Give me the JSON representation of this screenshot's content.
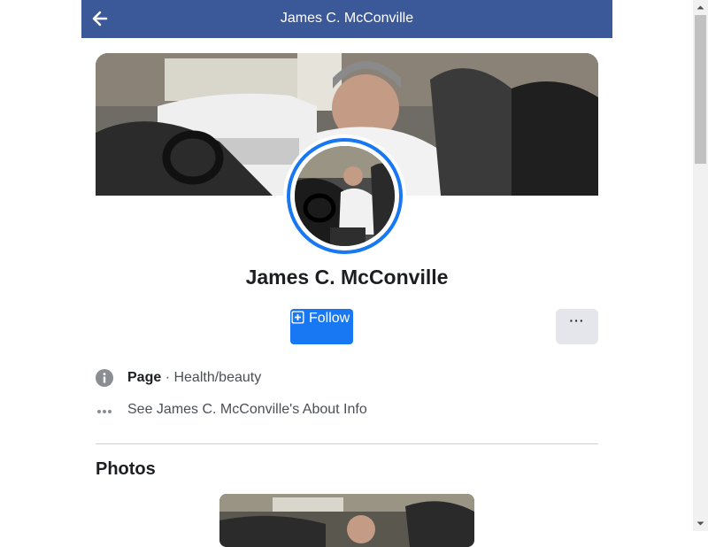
{
  "header": {
    "back_icon": "arrow-left-icon",
    "title": "James C. McConville",
    "background": "#3b5998"
  },
  "profile": {
    "cover_image": "cover-photo",
    "avatar_image": "profile-photo",
    "name": "James C. McConville"
  },
  "actions": {
    "follow_icon": "plus-square-icon",
    "follow_label": "Follow",
    "more_icon": "more-dots-icon",
    "more_label": "···",
    "accent": "#1877f2"
  },
  "info": {
    "category_icon": "info-icon",
    "category_type": "Page",
    "category_separator": " · ",
    "category_value": "Health/beauty",
    "about_icon": "ellipsis-icon",
    "about_link": "See James C. McConville's About Info"
  },
  "photos": {
    "heading": "Photos"
  },
  "scrollbar": {
    "up_icon": "scroll-up-arrow-icon",
    "down_icon": "scroll-down-arrow-icon"
  }
}
